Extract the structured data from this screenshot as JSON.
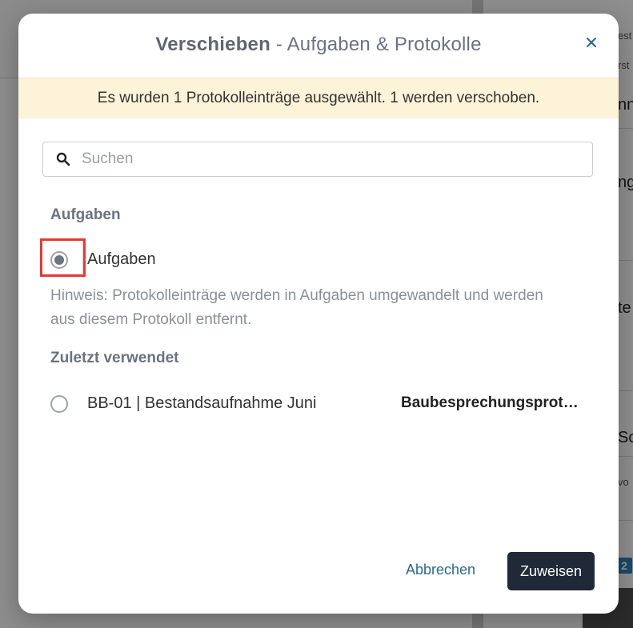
{
  "background": {
    "right_fragments": [
      "est",
      "rst",
      "nn",
      "ng",
      "te",
      "So",
      "vo"
    ],
    "badge": "2"
  },
  "modal": {
    "title_strong": "Verschieben",
    "title_rest": " - Aufgaben & Protokolle",
    "close_icon": "close-icon",
    "info_banner": "Es wurden 1 Protokolleinträge ausgewählt. 1 werden verschoben.",
    "search": {
      "placeholder": "Suchen",
      "value": ""
    },
    "section_tasks": {
      "heading": "Aufgaben",
      "option_label": "Aufgaben",
      "selected": true,
      "hint": "Hinweis: Protokolleinträge werden in Aufgaben umgewandelt und werden aus diesem Protokoll entfernt."
    },
    "section_recent": {
      "heading": "Zuletzt verwendet",
      "items": [
        {
          "label": "BB-01 | Bestandsaufnahme Juni",
          "type": "Baubesprechungsprotokoll",
          "selected": false
        }
      ]
    },
    "footer": {
      "cancel_label": "Abbrechen",
      "assign_label": "Zuweisen"
    }
  },
  "colors": {
    "accent": "#2b6a8a",
    "primary_button": "#1f2937",
    "banner": "#fdf3d8",
    "highlight": "#e53935"
  }
}
